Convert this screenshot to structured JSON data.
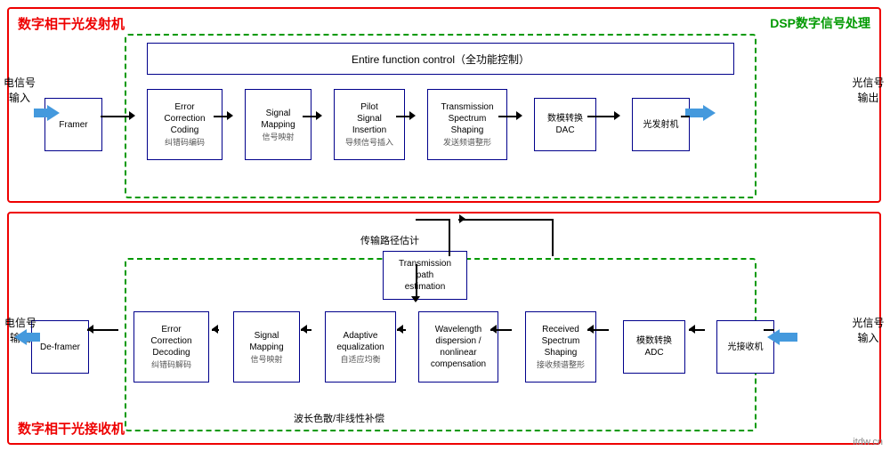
{
  "transmitter": {
    "label": "数字相干光发射机",
    "dsp_label": "DSP数字信号处理",
    "input_label": "电信号\n输入",
    "output_label": "光信号\n输出",
    "func_control": "Entire function control（全功能控制）",
    "blocks": [
      {
        "id": "framer",
        "title": "Framer",
        "subtitle": ""
      },
      {
        "id": "ecc",
        "title": "Error\nCorrection\nCoding",
        "subtitle": "纠错码编码"
      },
      {
        "id": "sm1",
        "title": "Signal\nMapping",
        "subtitle": "信号映射"
      },
      {
        "id": "psi",
        "title": "Pilot\nSignal\nInsertion",
        "subtitle": "导频信号插入"
      },
      {
        "id": "tss",
        "title": "Transmission\nSpectrum\nShaping",
        "subtitle": "发送频谱整形"
      },
      {
        "id": "dac",
        "title": "数模转换\nDAC",
        "subtitle": ""
      },
      {
        "id": "tx",
        "title": "光发射机",
        "subtitle": ""
      }
    ]
  },
  "receiver": {
    "label": "数字相干光接收机",
    "input_label": "光信号\n输入",
    "output_label": "电信号\n输出",
    "path_est_label": "传输路径估计",
    "nonlinear_label": "波长色散/非线性补偿",
    "blocks": [
      {
        "id": "deframer",
        "title": "De-framer",
        "subtitle": ""
      },
      {
        "id": "ecd",
        "title": "Error\nCorrection\nDecoding",
        "subtitle": "纠错码解码"
      },
      {
        "id": "sm2",
        "title": "Signal\nMapping",
        "subtitle": "信号映射"
      },
      {
        "id": "aeq",
        "title": "Adaptive\nequalization",
        "subtitle": "自适应均衡"
      },
      {
        "id": "wdnc",
        "title": "Wavelength\ndispersion /\nnonlinear\ncompensation",
        "subtitle": ""
      },
      {
        "id": "rss",
        "title": "Received\nSpectrum\nShaping",
        "subtitle": "接收频谱整形"
      },
      {
        "id": "adc",
        "title": "模数转换\nADC",
        "subtitle": ""
      },
      {
        "id": "rx",
        "title": "光接收机",
        "subtitle": ""
      },
      {
        "id": "tpe",
        "title": "Transmission\npath\nestimation",
        "subtitle": ""
      }
    ]
  },
  "watermark": "itdw.cn"
}
